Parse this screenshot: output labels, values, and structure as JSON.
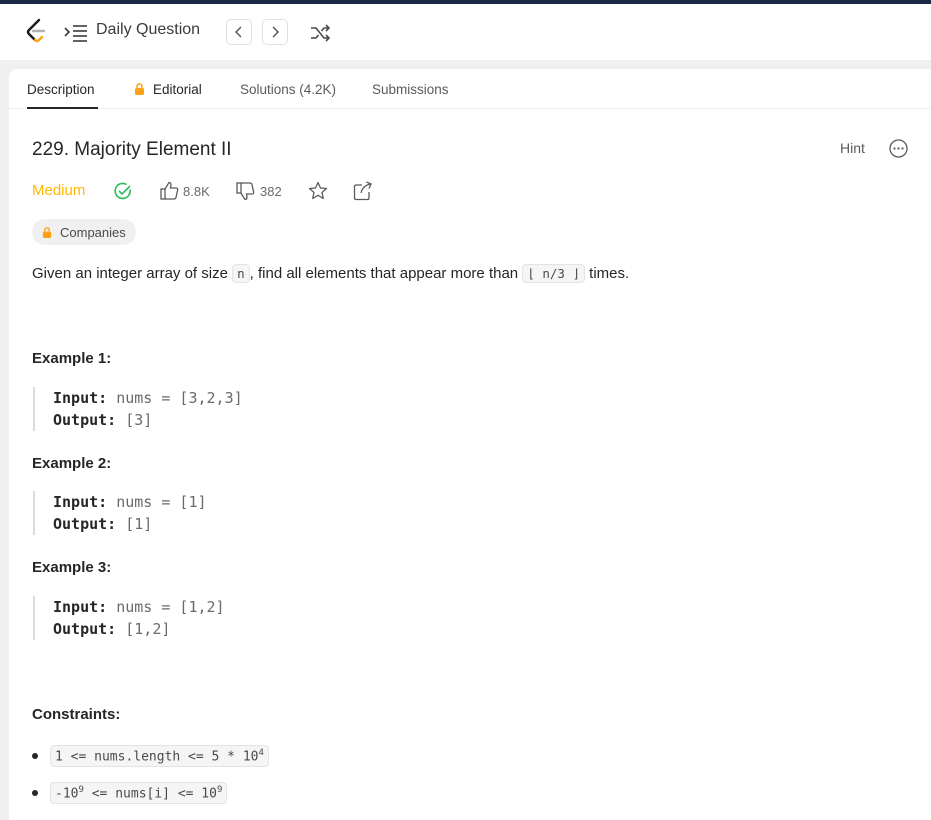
{
  "navbar": {
    "daily_question_label": "Daily Question"
  },
  "tabs": [
    {
      "label": "Description",
      "active": true
    },
    {
      "label": "Editorial",
      "locked": true
    },
    {
      "label": "Solutions (4.2K)"
    },
    {
      "label": "Submissions"
    }
  ],
  "problem": {
    "title": "229. Majority Element II",
    "hint_label": "Hint",
    "difficulty": "Medium",
    "likes": "8.8K",
    "dislikes": "382",
    "companies_label": "Companies",
    "description": {
      "before": "Given an integer array of size ",
      "var_n": "n",
      "middle": ", find all elements that appear more than ",
      "floor_expr": "⌊ n/3 ⌋",
      "after": " times."
    }
  },
  "examples": [
    {
      "title": "Example 1:",
      "input_label": "Input:",
      "input": "nums = [3,2,3]",
      "output_label": "Output:",
      "output": "[3]"
    },
    {
      "title": "Example 2:",
      "input_label": "Input:",
      "input": "nums = [1]",
      "output_label": "Output:",
      "output": "[1]"
    },
    {
      "title": "Example 3:",
      "input_label": "Input:",
      "input": "nums = [1,2]",
      "output_label": "Output:",
      "output": "[1,2]"
    }
  ],
  "constraints": {
    "title": "Constraints:",
    "items": [
      {
        "text": "1 <= nums.length <= 5 * 10",
        "sup": "4"
      },
      {
        "pre": "-10",
        "pre_sup": "9",
        "mid": " <= nums[i] <= 10",
        "sup": "9"
      }
    ]
  },
  "colors": {
    "difficulty_medium": "#ffb800",
    "solved_green": "#2cbb5d",
    "lock_orange": "#ffa116"
  },
  "icons": [
    "leetcode-logo",
    "problem-list-icon",
    "chevron-left-icon",
    "chevron-right-icon",
    "shuffle-icon",
    "lock-icon",
    "more-icon",
    "solved-check-icon",
    "thumbs-up-icon",
    "thumbs-down-icon",
    "star-icon",
    "share-icon"
  ]
}
